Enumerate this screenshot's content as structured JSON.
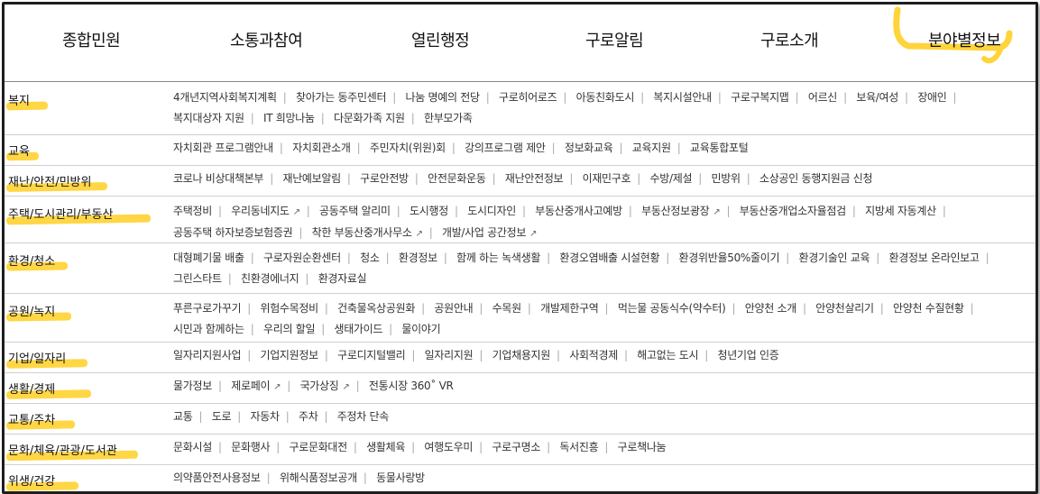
{
  "gnb": {
    "items": [
      "종합민원",
      "소통과참여",
      "열린행정",
      "구로알림",
      "구로소개",
      "분야별정보"
    ],
    "active_index": 5,
    "highlight_color": "#ffd43a"
  },
  "external_icon": "external-link-icon",
  "categories": [
    {
      "name": "복지",
      "links": [
        "4개년지역사회복지계획",
        "찾아가는 동주민센터",
        "나눔 명예의 전당",
        "구로히어로즈",
        "아동친화도시",
        "복지시설안내",
        "구로구복지맵",
        "어르신",
        "보육/여성",
        "장애인",
        "복지대상자 지원",
        "IT 희망나눔",
        "다문화가족 지원",
        "한부모가족"
      ]
    },
    {
      "name": "교육",
      "links": [
        "자치회관 프로그램안내",
        "자치회관소개",
        "주민자치(위원)회",
        "강의프로그램 제안",
        "정보화교육",
        "교육지원",
        "교육통합포털"
      ]
    },
    {
      "name": "재난/안전/민방위",
      "links": [
        "코로나 비상대책본부",
        "재난예보알림",
        "구로안전방",
        "안전문화운동",
        "재난안전정보",
        "이재민구호",
        "수방/제설",
        "민방위",
        "소상공인 동행지원금 신청"
      ]
    },
    {
      "name": "주택/도시관리/부동산",
      "links": [
        "주택정비",
        "우리동네지도",
        "공동주택 알리미",
        "도시행정",
        "도시디자인",
        "부동산중개사고예방",
        "부동산정보광장",
        "부동산중개업소자율점검",
        "지방세 자동계산",
        "공동주택 하자보증보험증권",
        "착한 부동산중개사무소",
        "개발/사업 공간정보"
      ],
      "external": [
        1,
        6,
        10,
        11
      ]
    },
    {
      "name": "환경/청소",
      "links": [
        "대형폐기물 배출",
        "구로자원순환센터",
        "청소",
        "환경정보",
        "함께 하는 녹색생활",
        "환경오염배출 시설현황",
        "환경위반율50%줄이기",
        "환경기술인 교육",
        "환경정보 온라인보고",
        "그린스타트",
        "친환경에너지",
        "환경자료실"
      ]
    },
    {
      "name": "공원/녹지",
      "links": [
        "푸른구로가꾸기",
        "위험수목정비",
        "건축물옥상공원화",
        "공원안내",
        "수목원",
        "개발제한구역",
        "먹는물 공동식수(약수터)",
        "안양천 소개",
        "안양천살리기",
        "안양천 수질현황",
        "시민과 함께하는",
        "우리의 할일",
        "생태가이드",
        "물이야기"
      ]
    },
    {
      "name": "기업/일자리",
      "links": [
        "일자리지원사업",
        "기업지원정보",
        "구로디지털밸리",
        "일자리지원",
        "기업채용지원",
        "사회적경제",
        "해고없는 도시",
        "청년기업 인증"
      ]
    },
    {
      "name": "생활/경제",
      "links": [
        "물가정보",
        "제로페이",
        "국가상징",
        "전통시장 360˚ VR"
      ],
      "external": [
        1,
        2
      ]
    },
    {
      "name": "교통/주차",
      "links": [
        "교통",
        "도로",
        "자동차",
        "주차",
        "주정차 단속"
      ]
    },
    {
      "name": "문화/체육/관광/도서관",
      "links": [
        "문화시설",
        "문화행사",
        "구로문화대전",
        "생활체육",
        "여행도우미",
        "구로구명소",
        "독서진흥",
        "구로책나눔"
      ]
    },
    {
      "name": "위생/건강",
      "links": [
        "의약품안전사용정보",
        "위해식품정보공개",
        "동물사랑방"
      ]
    }
  ]
}
